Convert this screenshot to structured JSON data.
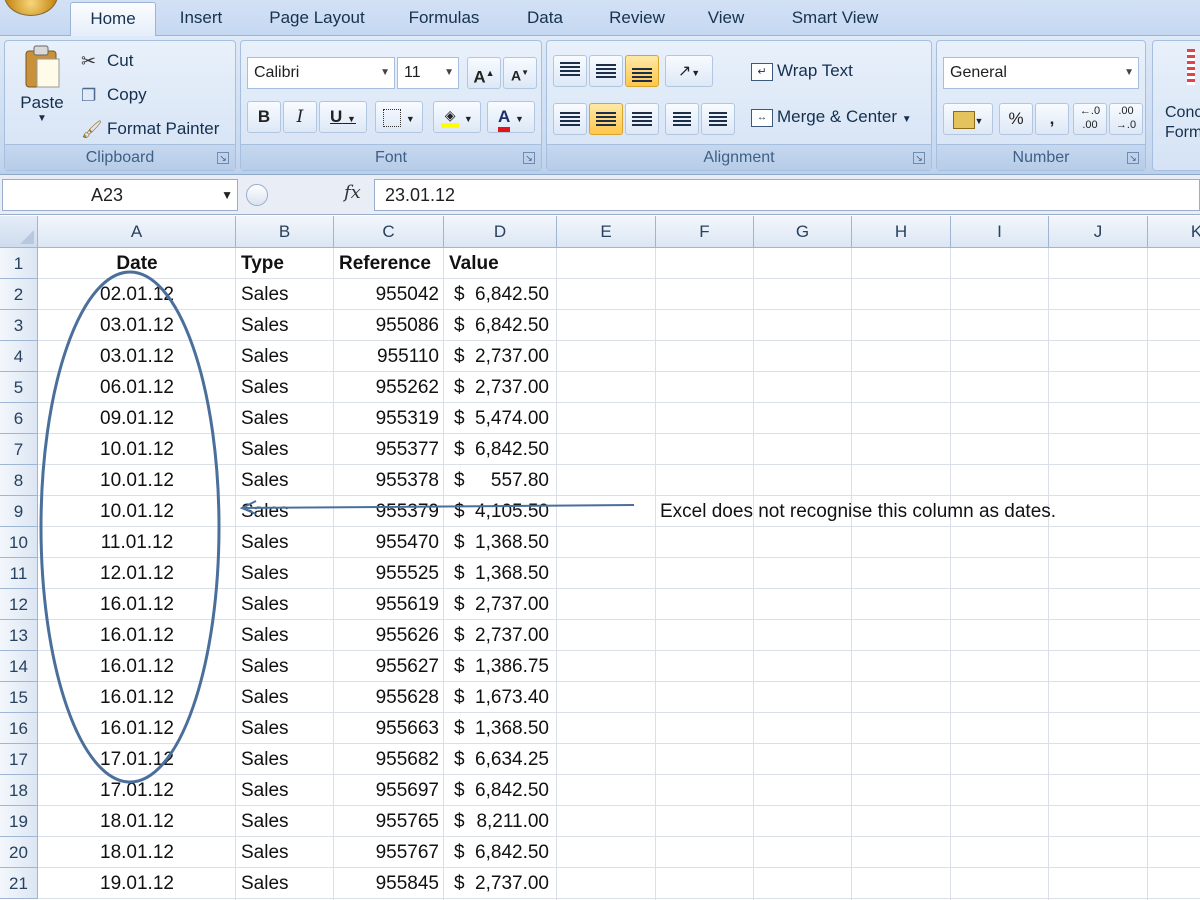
{
  "tabs": [
    "Home",
    "Insert",
    "Page Layout",
    "Formulas",
    "Data",
    "Review",
    "View",
    "Smart View"
  ],
  "clipboard": {
    "title": "Clipboard",
    "paste": "Paste",
    "cut": "Cut",
    "copy": "Copy",
    "format_painter": "Format Painter"
  },
  "font": {
    "title": "Font",
    "family": "Calibri",
    "size": "11",
    "bold": "B",
    "italic": "I",
    "underline": "U",
    "grow": "A",
    "shrink": "A",
    "font_color_glyph": "A"
  },
  "alignment": {
    "title": "Alignment",
    "wrap_text": "Wrap Text",
    "merge_center": "Merge & Center"
  },
  "number": {
    "title": "Number",
    "format": "General",
    "percent": "%",
    "comma": ",",
    "inc_decimal": ".00",
    "dec_decimal": ".0"
  },
  "styles_partial": {
    "line1": "Conc",
    "line2": "Form"
  },
  "formula_bar": {
    "name_box": "A23",
    "fx": "fx",
    "formula": "23.01.12"
  },
  "columns": [
    "A",
    "B",
    "C",
    "D",
    "E",
    "F",
    "G",
    "H",
    "I",
    "J",
    "K"
  ],
  "row_numbers": [
    "1",
    "2",
    "3",
    "4",
    "5",
    "6",
    "7",
    "8",
    "9",
    "10",
    "11",
    "12",
    "13",
    "14",
    "15",
    "16",
    "17",
    "18",
    "19",
    "20",
    "21"
  ],
  "header_row": {
    "date": "Date",
    "type": "Type",
    "reference": "Reference",
    "value": "Value"
  },
  "currency_symbol": "$",
  "rows": [
    {
      "date": "02.01.12",
      "type": "Sales",
      "reference": "955042",
      "value": "6,842.50"
    },
    {
      "date": "03.01.12",
      "type": "Sales",
      "reference": "955086",
      "value": "6,842.50"
    },
    {
      "date": "03.01.12",
      "type": "Sales",
      "reference": "955110",
      "value": "2,737.00"
    },
    {
      "date": "06.01.12",
      "type": "Sales",
      "reference": "955262",
      "value": "2,737.00"
    },
    {
      "date": "09.01.12",
      "type": "Sales",
      "reference": "955319",
      "value": "5,474.00"
    },
    {
      "date": "10.01.12",
      "type": "Sales",
      "reference": "955377",
      "value": "6,842.50"
    },
    {
      "date": "10.01.12",
      "type": "Sales",
      "reference": "955378",
      "value": "557.80"
    },
    {
      "date": "10.01.12",
      "type": "Sales",
      "reference": "955379",
      "value": "4,105.50"
    },
    {
      "date": "11.01.12",
      "type": "Sales",
      "reference": "955470",
      "value": "1,368.50"
    },
    {
      "date": "12.01.12",
      "type": "Sales",
      "reference": "955525",
      "value": "1,368.50"
    },
    {
      "date": "16.01.12",
      "type": "Sales",
      "reference": "955619",
      "value": "2,737.00"
    },
    {
      "date": "16.01.12",
      "type": "Sales",
      "reference": "955626",
      "value": "2,737.00"
    },
    {
      "date": "16.01.12",
      "type": "Sales",
      "reference": "955627",
      "value": "1,386.75"
    },
    {
      "date": "16.01.12",
      "type": "Sales",
      "reference": "955628",
      "value": "1,673.40"
    },
    {
      "date": "16.01.12",
      "type": "Sales",
      "reference": "955663",
      "value": "1,368.50"
    },
    {
      "date": "17.01.12",
      "type": "Sales",
      "reference": "955682",
      "value": "6,634.25"
    },
    {
      "date": "17.01.12",
      "type": "Sales",
      "reference": "955697",
      "value": "6,842.50"
    },
    {
      "date": "18.01.12",
      "type": "Sales",
      "reference": "955765",
      "value": "8,211.00"
    },
    {
      "date": "18.01.12",
      "type": "Sales",
      "reference": "955767",
      "value": "6,842.50"
    },
    {
      "date": "19.01.12",
      "type": "Sales",
      "reference": "955845",
      "value": "2,737.00"
    }
  ],
  "annotation": {
    "note": "Excel does not recognise this column as dates.",
    "color": "#4a6f9a"
  }
}
